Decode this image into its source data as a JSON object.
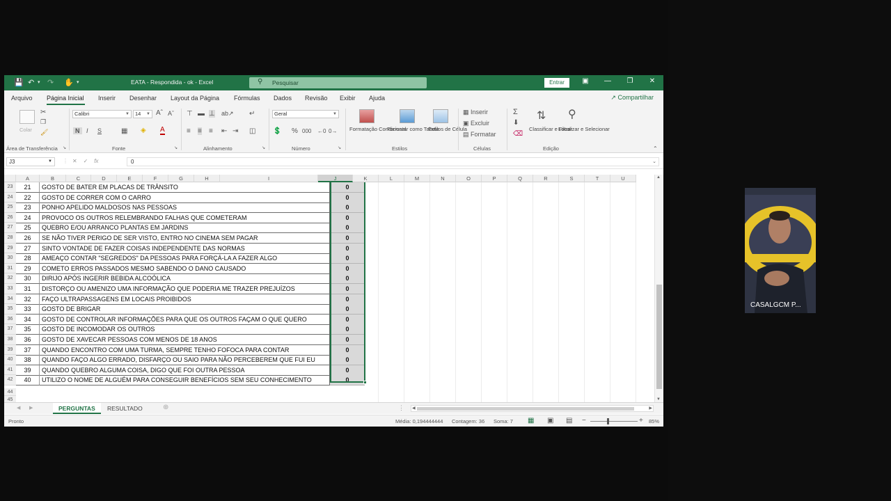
{
  "titlebar": {
    "title": "EATA - Respondida - ok  -  Excel",
    "search_placeholder": "Pesquisar",
    "signin_label": "Entrar"
  },
  "tabs": [
    "Arquivo",
    "Página Inicial",
    "Inserir",
    "Desenhar",
    "Layout da Página",
    "Fórmulas",
    "Dados",
    "Revisão",
    "Exibir",
    "Ajuda"
  ],
  "active_tab": "Página Inicial",
  "share_label": "Compartilhar",
  "ribbon": {
    "clipboard": {
      "paste_label": "Colar",
      "group_label": "Área de Transferência"
    },
    "font": {
      "font_name": "Calibri",
      "font_size": "14",
      "group_label": "Fonte"
    },
    "alignment": {
      "group_label": "Alinhamento"
    },
    "number": {
      "format": "Geral",
      "group_label": "Número"
    },
    "styles": {
      "conditional_label": "Formatação Condicional",
      "table_label": "Formatar como Tabela",
      "cell_styles_label": "Estilos de Célula",
      "group_label": "Estilos"
    },
    "cells": {
      "insert_label": "Inserir",
      "delete_label": "Excluir",
      "format_label": "Formatar",
      "group_label": "Células"
    },
    "editing": {
      "sort_label": "Classificar e Filtrar",
      "find_label": "Localizar e Selecionar",
      "group_label": "Edição"
    }
  },
  "formula_bar": {
    "name_box": "J3",
    "fx_label": "fx",
    "formula": "0"
  },
  "columns": [
    "A",
    "B",
    "C",
    "D",
    "E",
    "F",
    "G",
    "H",
    "I",
    "J",
    "K",
    "L",
    "M",
    "N",
    "O",
    "P",
    "Q",
    "R",
    "S",
    "T",
    "U"
  ],
  "selected_column": "J",
  "rows": [
    {
      "row": "23",
      "num": "21",
      "text": "GOSTO DE BATER EM PLACAS DE TRÂNSITO",
      "value": "0"
    },
    {
      "row": "24",
      "num": "22",
      "text": "GOSTO DE CORRER COM O CARRO",
      "value": "0"
    },
    {
      "row": "25",
      "num": "23",
      "text": "PONHO APELIDO MALDOSOS NAS PESSOAS",
      "value": "0"
    },
    {
      "row": "26",
      "num": "24",
      "text": "PROVOCO OS OUTROS RELEMBRANDO FALHAS QUE COMETERAM",
      "value": "0"
    },
    {
      "row": "27",
      "num": "25",
      "text": "QUEBRO E/OU ARRANCO PLANTAS EM JARDINS",
      "value": "0"
    },
    {
      "row": "28",
      "num": "26",
      "text": "SE NÃO TIVER PERIGO DE SER VISTO, ENTRO NO CINEMA SEM PAGAR",
      "value": "0"
    },
    {
      "row": "29",
      "num": "27",
      "text": "SINTO VONTADE DE FAZER COISAS INDEPENDENTE DAS NORMAS",
      "value": "0"
    },
    {
      "row": "30",
      "num": "28",
      "text": "AMEAÇO CONTAR \"SEGREDOS\" DA PESSOAS PARA FORÇÁ-LA A FAZER ALGO",
      "value": "0"
    },
    {
      "row": "31",
      "num": "29",
      "text": "COMETO ERROS PASSADOS MESMO SABENDO O DANO CAUSADO",
      "value": "0"
    },
    {
      "row": "32",
      "num": "30",
      "text": "DIRIJO APÓS INGERIR BEBIDA ALCOÓLICA",
      "value": "0"
    },
    {
      "row": "33",
      "num": "31",
      "text": "DISTORÇO OU AMENIZO UMA INFORMAÇÃO QUE PODERIA ME TRAZER PREJUÍZOS",
      "value": "0"
    },
    {
      "row": "34",
      "num": "32",
      "text": "FAÇO ULTRAPASSAGENS EM LOCAIS PROIBIDOS",
      "value": "0"
    },
    {
      "row": "35",
      "num": "33",
      "text": "GOSTO DE BRIGAR",
      "value": "0"
    },
    {
      "row": "36",
      "num": "34",
      "text": "GOSTO DE CONTROLAR INFORMAÇÕES PARA QUE OS OUTROS FAÇAM O QUE QUERO",
      "value": "0"
    },
    {
      "row": "37",
      "num": "35",
      "text": "GOSTO DE INCOMODAR OS OUTROS",
      "value": "0"
    },
    {
      "row": "38",
      "num": "36",
      "text": "GOSTO DE XAVECAR PESSOAS COM MENOS DE 18 ANOS",
      "value": "0"
    },
    {
      "row": "39",
      "num": "37",
      "text": "QUANDO ENCONTRO COM UMA TURMA, SEMPRE TENHO FOFOCA PARA CONTAR",
      "value": "0"
    },
    {
      "row": "40",
      "num": "38",
      "text": "QUANDO FAÇO ALGO ERRADO, DISFARÇO OU SAIO PARA NÃO PERCEBEREM QUE FUI EU",
      "value": "0"
    },
    {
      "row": "41",
      "num": "39",
      "text": "QUANDO QUEBRO ALGUMA COISA, DIGO QUE FOI OUTRA PESSOA",
      "value": "0"
    },
    {
      "row": "42",
      "num": "40",
      "text": "UTILIZO O NOME DE ALGUÉM PARA CONSEGUIR BENEFÍCIOS SEM SEU CONHECIMENTO",
      "value": "0"
    }
  ],
  "empty_rows": [
    "44",
    "45"
  ],
  "sheet_tabs": [
    "PERGUNTAS",
    "RESULTADO"
  ],
  "active_sheet": "PERGUNTAS",
  "statusbar": {
    "ready": "Pronto",
    "average": "Média: 0,194444444",
    "count": "Contagem: 36",
    "sum": "Soma: 7",
    "zoom": "85%"
  },
  "webcam": {
    "label": "CASALGCM P..."
  },
  "colors": {
    "excel_green": "#217346",
    "selection": "#217346"
  }
}
